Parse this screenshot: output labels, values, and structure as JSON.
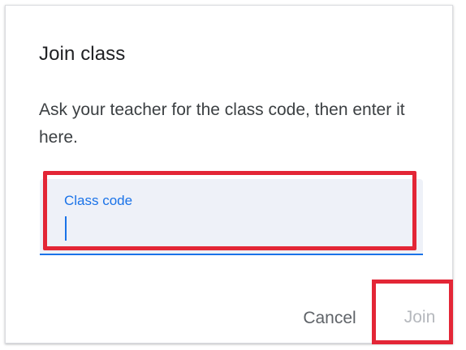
{
  "dialog": {
    "title": "Join class",
    "description": "Ask your teacher for the class code, then enter it here."
  },
  "class_code_field": {
    "label": "Class code",
    "value": "",
    "placeholder": ""
  },
  "actions": {
    "cancel_label": "Cancel",
    "join_label": "Join"
  },
  "colors": {
    "accent": "#1a73e8",
    "field_background": "#eef1f8",
    "highlight_border": "#e32636",
    "disabled_text": "#b5b8bd"
  }
}
